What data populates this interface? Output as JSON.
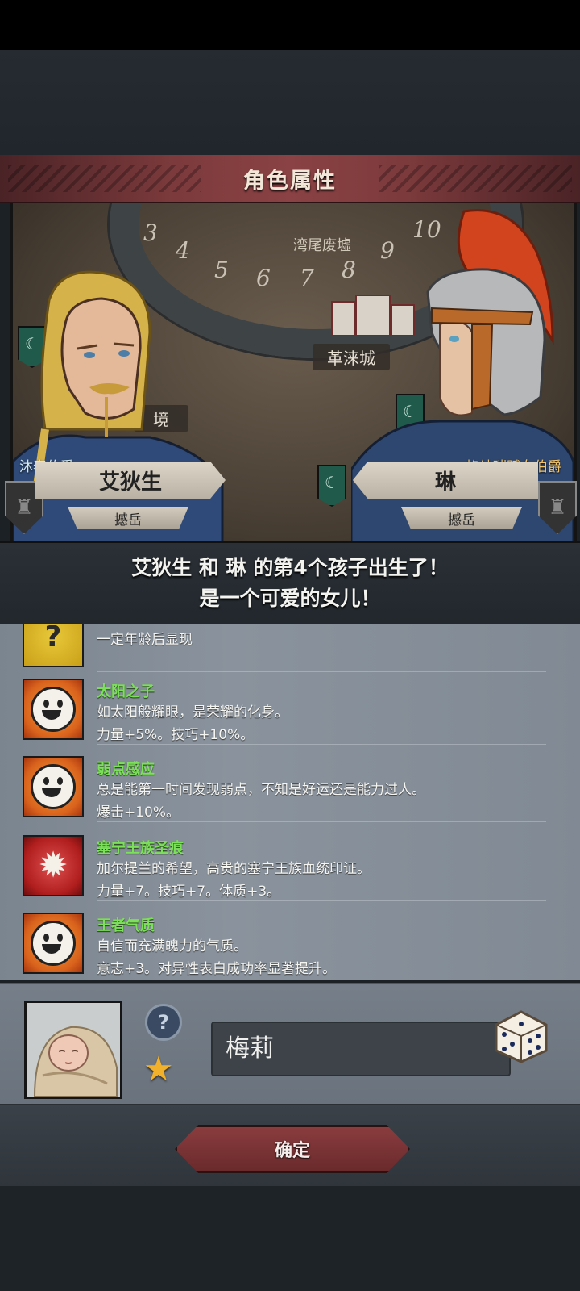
{
  "dialog": {
    "title": "角色属性"
  },
  "scene": {
    "map_ring_numbers": [
      "3",
      "4",
      "5",
      "6",
      "7",
      "8",
      "9",
      "10"
    ],
    "locations": {
      "city": "革涞城",
      "ruins": "湾尾废墟",
      "partial": "境"
    }
  },
  "parents": {
    "father": {
      "title": "沐春伯爵",
      "name": "艾狄生",
      "house": "撼岳"
    },
    "mother": {
      "title": "格纳瑞赋女伯爵",
      "name": "琳",
      "house": "撼岳"
    }
  },
  "announcement": {
    "line1": "艾狄生 和 琳 的第4个孩子出生了！",
    "line2": "是一个可爱的女儿！"
  },
  "traits": [
    {
      "icon": "question-icon",
      "name": "",
      "desc1": "一定年龄后显现",
      "desc2": ""
    },
    {
      "icon": "smiley-icon",
      "name": "太阳之子",
      "desc1": "如太阳般耀眼，是荣耀的化身。",
      "desc2": "力量+5%。技巧+10%。"
    },
    {
      "icon": "smiley-icon",
      "name": "弱点感应",
      "desc1": "总是能第一时间发现弱点，不知是好运还是能力过人。",
      "desc2": "爆击+10%。"
    },
    {
      "icon": "sun-emblem-icon",
      "name": "塞宁王族圣痕",
      "desc1": "加尔提兰的希望，高贵的塞宁王族血统印证。",
      "desc2": "力量+7。技巧+7。体质+3。"
    },
    {
      "icon": "smiley-icon",
      "name": "王者气质",
      "desc1": "自信而充满魄力的气质。",
      "desc2": "意志+3。对异性表白成功率显著提升。"
    }
  ],
  "child": {
    "name_value": "梅莉"
  },
  "buttons": {
    "confirm": "确定"
  },
  "colors": {
    "trait_name": "#7de05a",
    "accent_red": "#8a3c3e",
    "title_tag": "#f2c46b"
  }
}
